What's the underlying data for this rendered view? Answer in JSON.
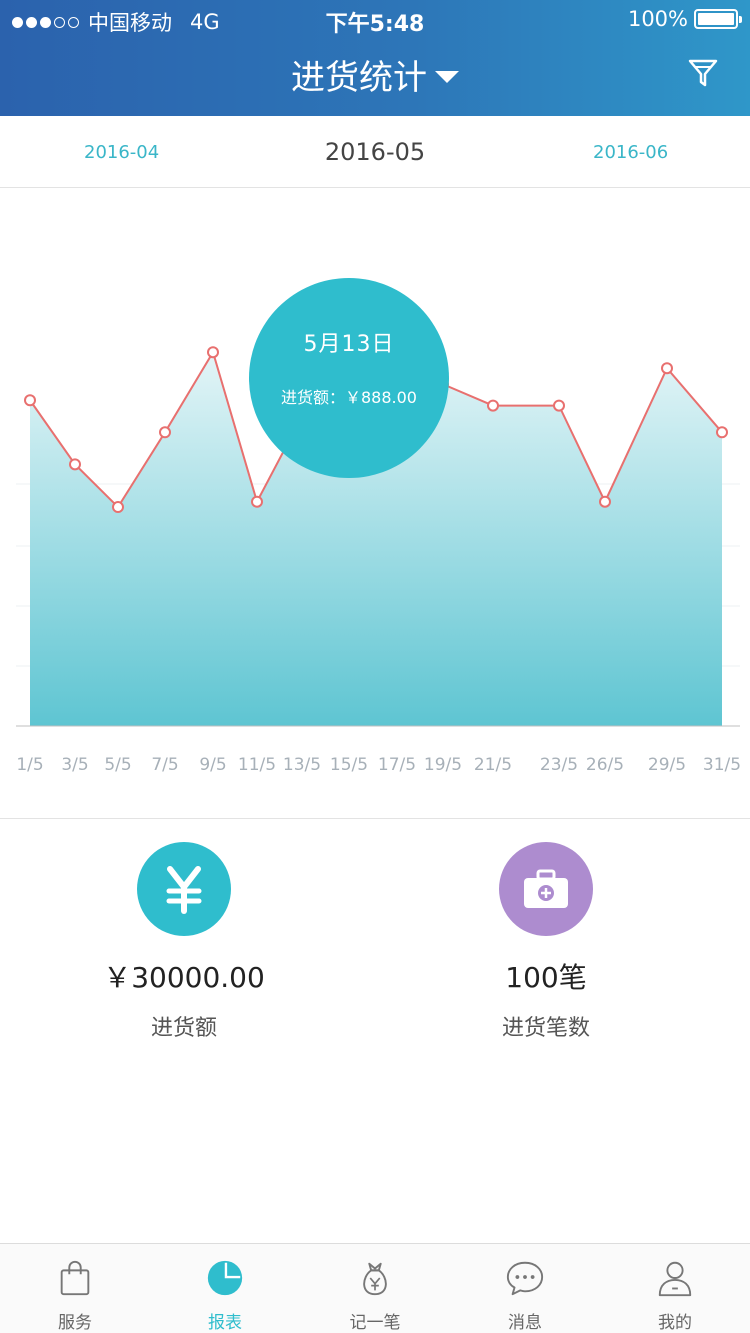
{
  "status_bar": {
    "carrier": "中国移动",
    "network": "4G",
    "time": "下午5:48",
    "battery": "100%"
  },
  "header": {
    "title": "进货统计",
    "filter_icon": "filter-icon"
  },
  "month_switcher": {
    "previous": "2016-04",
    "current": "2016-05",
    "next": "2016-06"
  },
  "tooltip": {
    "date": "5月13日",
    "value": "进货额：￥888.00"
  },
  "chart_data": {
    "type": "area",
    "x": [
      "1/5",
      "3/5",
      "5/5",
      "7/5",
      "9/5",
      "11/5",
      "13/5",
      "15/5",
      "17/5",
      "19/5",
      "21/5",
      "23/5",
      "26/5",
      "29/5",
      "31/5"
    ],
    "values": [
      610,
      490,
      410,
      550,
      700,
      420,
      580,
      650,
      580,
      640,
      600,
      600,
      420,
      670,
      550
    ],
    "colors": {
      "line": "#e8706f",
      "area_top": "#dff3f6",
      "area_bottom": "#5ec5d2"
    }
  },
  "summary": {
    "amount_value": "￥30000.00",
    "amount_label": "进货额",
    "count_value": "100笔",
    "count_label": "进货笔数",
    "amount_icon": "yen-icon",
    "count_icon": "toolbox-icon"
  },
  "tabs": [
    {
      "label": "服务",
      "icon": "shopping-bag-icon"
    },
    {
      "label": "报表",
      "icon": "pie-chart-icon"
    },
    {
      "label": "记一笔",
      "icon": "money-bag-icon"
    },
    {
      "label": "消息",
      "icon": "chat-bubble-icon"
    },
    {
      "label": "我的",
      "icon": "user-icon"
    }
  ],
  "colors": {
    "accent": "#2fbdcd",
    "header_start": "#2b62ad",
    "header_end": "#2f97c9",
    "purple": "#ad8ccf"
  }
}
